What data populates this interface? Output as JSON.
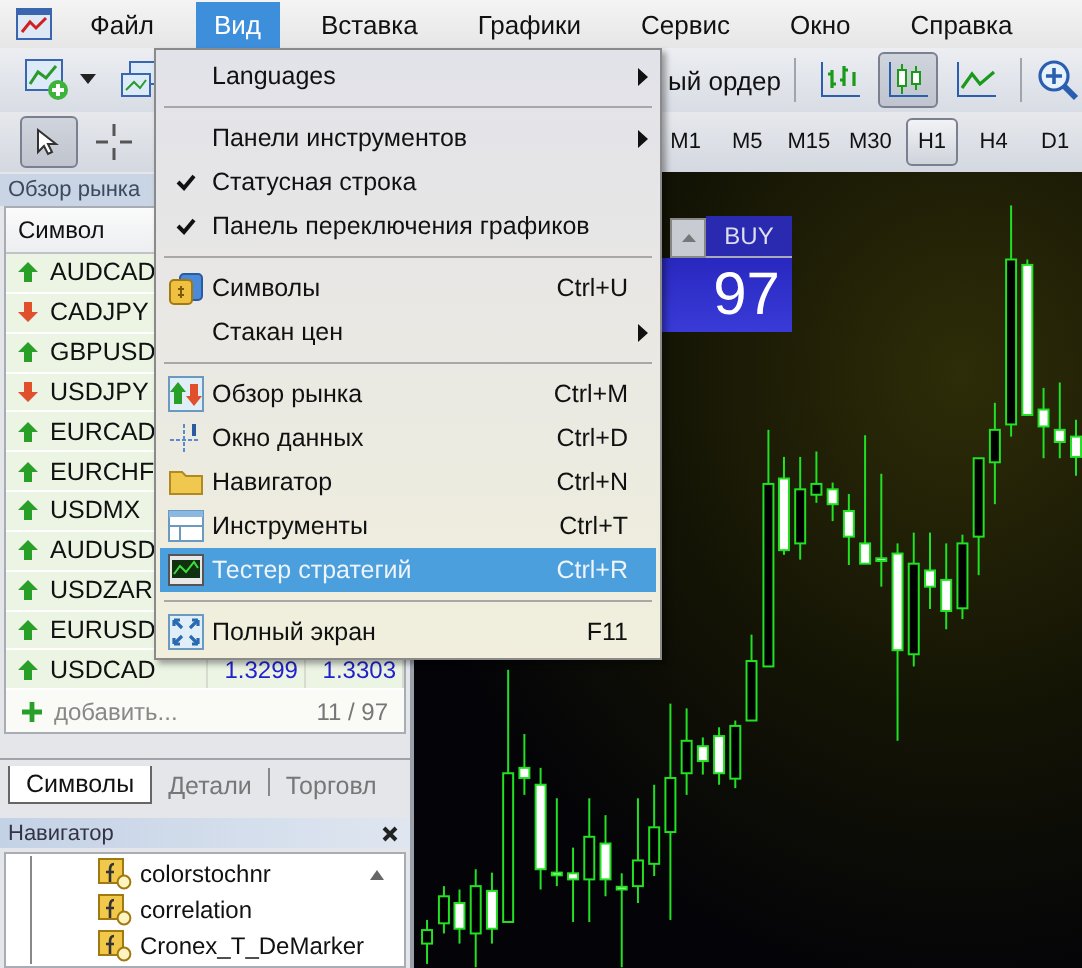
{
  "menubar": [
    {
      "label": "Файл",
      "selected": false
    },
    {
      "label": "Вид",
      "selected": true
    },
    {
      "label": "Вставка",
      "selected": false
    },
    {
      "label": "Графики",
      "selected": false
    },
    {
      "label": "Сервис",
      "selected": false
    },
    {
      "label": "Окно",
      "selected": false
    },
    {
      "label": "Справка",
      "selected": false
    }
  ],
  "toolbar": {
    "order_label": "ый ордер",
    "chart_types": [
      {
        "kind": "bars",
        "selected": false
      },
      {
        "kind": "candles",
        "selected": true
      },
      {
        "kind": "line",
        "selected": false
      }
    ]
  },
  "tools": [
    {
      "kind": "cursor",
      "selected": true
    },
    {
      "kind": "crosshair",
      "selected": false
    }
  ],
  "timeframes": [
    {
      "label": "M1",
      "selected": false
    },
    {
      "label": "M5",
      "selected": false
    },
    {
      "label": "M15",
      "selected": false
    },
    {
      "label": "M30",
      "selected": false
    },
    {
      "label": "H1",
      "selected": true
    },
    {
      "label": "H4",
      "selected": false
    },
    {
      "label": "D1",
      "selected": false
    }
  ],
  "market_watch": {
    "title": "Обзор рынка",
    "column": "Символ",
    "rows": [
      {
        "symbol": "AUDCAD",
        "rising": true
      },
      {
        "symbol": "CADJPY",
        "rising": false
      },
      {
        "symbol": "GBPUSD",
        "rising": true
      },
      {
        "symbol": "USDJPY",
        "rising": false
      },
      {
        "symbol": "EURCAD",
        "rising": true
      },
      {
        "symbol": "EURCHF",
        "rising": true
      },
      {
        "symbol": "USDMX",
        "rising": true
      },
      {
        "symbol": "AUDUSD",
        "rising": true
      },
      {
        "symbol": "USDZAR",
        "rising": true
      },
      {
        "symbol": "EURUSD",
        "rising": true
      },
      {
        "symbol": "USDCAD",
        "rising": true,
        "bid": "1.3299",
        "ask": "1.3303"
      }
    ],
    "add_label": "добавить...",
    "count": "11 / 97",
    "tabs": [
      {
        "label": "Символы",
        "selected": true
      },
      {
        "label": "Детали",
        "selected": false
      },
      {
        "label": "Торговл",
        "selected": false
      }
    ]
  },
  "navigator": {
    "title": "Навигатор",
    "items": [
      "colorstochnr",
      "correlation",
      "Cronex_T_DeMarker"
    ]
  },
  "trade_panel": {
    "buy_label": "BUY",
    "price": "97"
  },
  "view_menu": [
    {
      "kind": "item",
      "label": "Languages",
      "submenu": true,
      "checked": false,
      "selected": false
    },
    {
      "kind": "separator"
    },
    {
      "kind": "item",
      "label": "Панели инструментов",
      "submenu": true,
      "checked": false,
      "selected": false
    },
    {
      "kind": "item",
      "label": "Статусная строка",
      "submenu": false,
      "checked": true,
      "selected": false
    },
    {
      "kind": "item",
      "label": "Панель переключения графиков",
      "submenu": false,
      "checked": true,
      "selected": false
    },
    {
      "kind": "separator"
    },
    {
      "kind": "item",
      "label": "Символы",
      "shortcut": "Ctrl+U",
      "submenu": false,
      "checked": false,
      "selected": false
    },
    {
      "kind": "item",
      "label": "Стакан цен",
      "submenu": true,
      "checked": false,
      "selected": false
    },
    {
      "kind": "separator"
    },
    {
      "kind": "item",
      "label": "Обзор рынка",
      "shortcut": "Ctrl+M",
      "submenu": false,
      "checked": false,
      "selected": false
    },
    {
      "kind": "item",
      "label": "Окно данных",
      "shortcut": "Ctrl+D",
      "submenu": false,
      "checked": false,
      "selected": false
    },
    {
      "kind": "item",
      "label": "Навигатор",
      "shortcut": "Ctrl+N",
      "submenu": false,
      "checked": false,
      "selected": false
    },
    {
      "kind": "item",
      "label": "Инструменты",
      "shortcut": "Ctrl+T",
      "submenu": false,
      "checked": false,
      "selected": false
    },
    {
      "kind": "item",
      "label": "Тестер стратегий",
      "shortcut": "Ctrl+R",
      "submenu": false,
      "checked": false,
      "selected": true
    },
    {
      "kind": "separator"
    },
    {
      "kind": "item",
      "label": "Полный экран",
      "shortcut": "F11",
      "submenu": false,
      "checked": false,
      "selected": false
    }
  ]
}
